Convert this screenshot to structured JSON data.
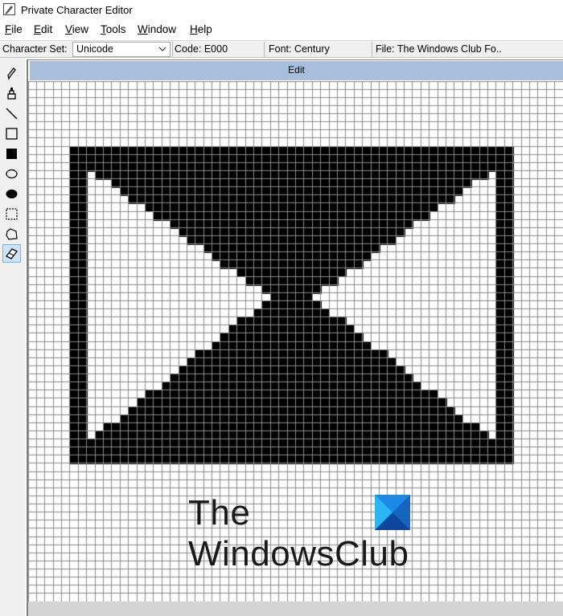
{
  "window": {
    "title": "Private Character Editor"
  },
  "menu": [
    {
      "mnemonic": "F",
      "rest": "ile"
    },
    {
      "mnemonic": "E",
      "rest": "dit"
    },
    {
      "mnemonic": "V",
      "rest": "iew"
    },
    {
      "mnemonic": "T",
      "rest": "ools"
    },
    {
      "mnemonic": "W",
      "rest": "indow"
    },
    {
      "mnemonic": "H",
      "rest": "elp"
    }
  ],
  "status": {
    "charset_label": "Character Set:",
    "charset_value": "Unicode",
    "code": "Code: E000",
    "font": "Font: Century",
    "file": "File: The Windows Club  Fo.."
  },
  "tools": [
    {
      "icon": "pencil-icon"
    },
    {
      "icon": "brush-icon"
    },
    {
      "icon": "line-icon"
    },
    {
      "icon": "hollow-rectangle-icon"
    },
    {
      "icon": "filled-rectangle-icon"
    },
    {
      "icon": "hollow-ellipse-icon"
    },
    {
      "icon": "filled-ellipse-icon"
    },
    {
      "icon": "rectangular-selection-icon"
    },
    {
      "icon": "freeform-selection-icon"
    },
    {
      "icon": "eraser-icon",
      "active": true
    }
  ],
  "edit_window": {
    "caption": "Edit"
  },
  "glyph": {
    "grid_cols": 64,
    "grid_rows": 64,
    "ink_color": "#000000",
    "grid_line_color": "#8a8a8a"
  },
  "watermark": {
    "line1": "The",
    "line2": "WindowsClub",
    "logo_colors": [
      "#1e88e5",
      "#29b6f6",
      "#0d47a1",
      "#1565c0"
    ]
  },
  "colors": {
    "caption_bg": "#a7bfdc",
    "toolbar_bg": "#f0f0f0",
    "active_tool_bg": "#cce4f7"
  }
}
